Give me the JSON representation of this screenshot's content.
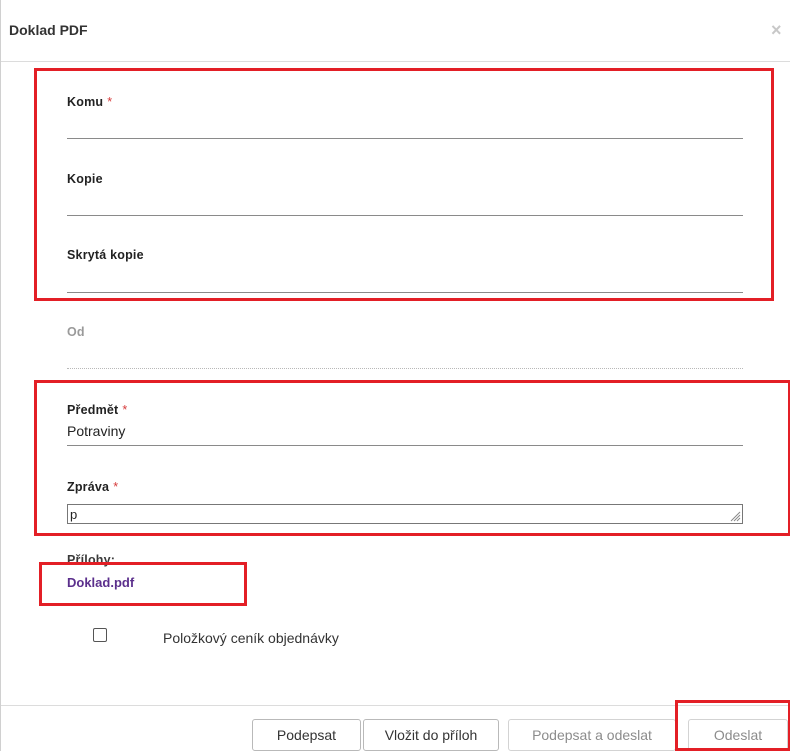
{
  "dialog": {
    "title": "Doklad PDF",
    "close_glyph": "×"
  },
  "fields": {
    "to": {
      "label": "Komu",
      "required_mark": "*",
      "value": ""
    },
    "cc": {
      "label": "Kopie",
      "value": ""
    },
    "bcc": {
      "label": "Skrytá kopie",
      "value": ""
    },
    "from": {
      "label": "Od",
      "value": ""
    },
    "subject": {
      "label": "Předmět",
      "required_mark": "*",
      "value": "Potraviny"
    },
    "message": {
      "label": "Zpráva",
      "required_mark": "*",
      "value": "p"
    }
  },
  "attachments": {
    "label": "Přílohy:",
    "items": [
      "Doklad.pdf"
    ]
  },
  "options": {
    "price_list_label": "Položkový ceník objednávky",
    "price_list_checked": false
  },
  "buttons": {
    "sign": "Podepsat",
    "insert_attachment": "Vložit do příloh",
    "sign_and_send": "Podepsat a odeslat",
    "send": "Odeslat"
  },
  "icons": {
    "close": "close-icon",
    "resize": "resize-grip-icon",
    "checkbox": "checkbox-icon"
  },
  "colors": {
    "highlight": "#e31f26",
    "required": "#d63a3a",
    "link": "#5b2f8c"
  }
}
